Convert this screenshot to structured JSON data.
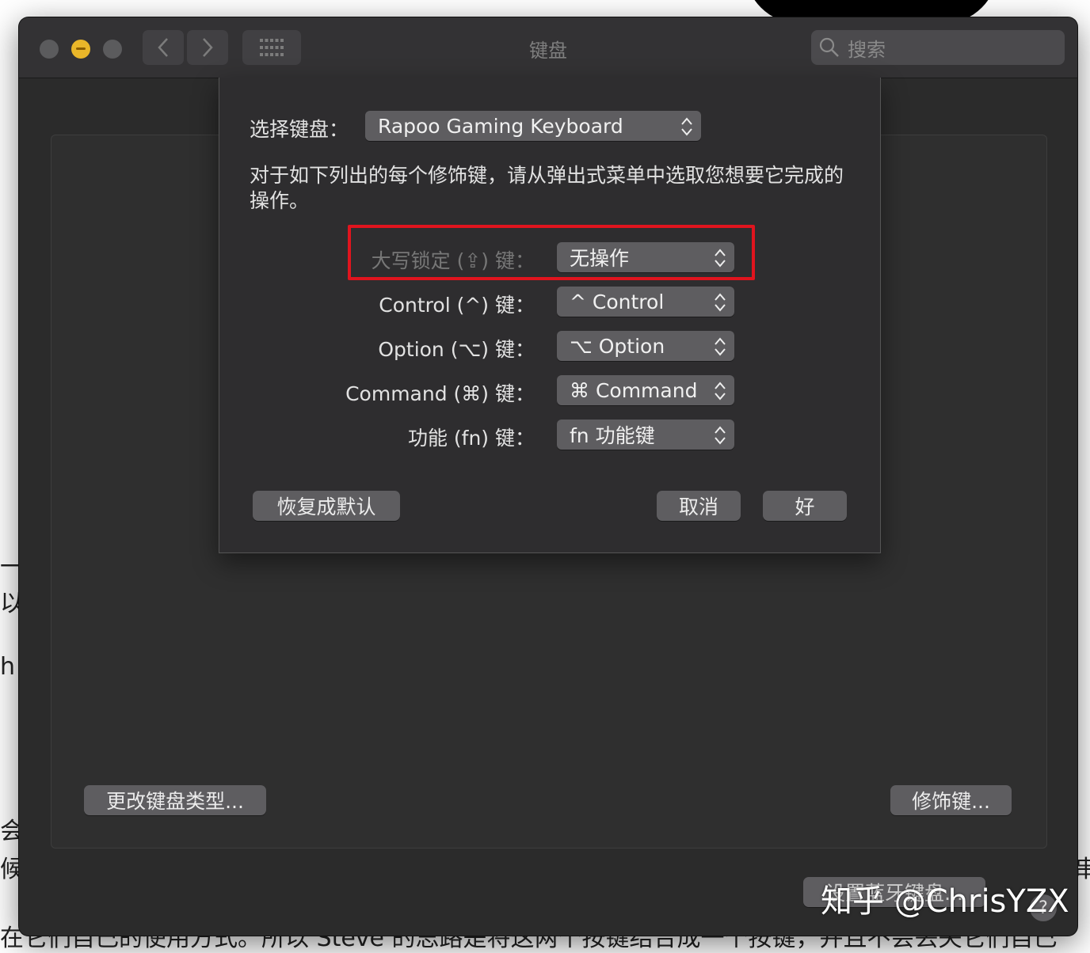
{
  "window": {
    "title": "键盘",
    "search_placeholder": "搜索"
  },
  "sheet": {
    "select_keyboard_label": "选择键盘：",
    "selected_keyboard": "Rapoo Gaming Keyboard",
    "instruction": "对于如下列出的每个修饰键，请从弹出式菜单中选取您想要它完成的操作。",
    "modifiers": [
      {
        "label": "大写锁定 (⇪) 键：",
        "value": "无操作",
        "dimmed": true
      },
      {
        "label": "Control (^) 键：",
        "value": "^ Control"
      },
      {
        "label": "Option (⌥) 键：",
        "value": "⌥ Option"
      },
      {
        "label": "Command (⌘) 键：",
        "value": "⌘ Command"
      },
      {
        "label": "功能 (fn) 键：",
        "value": "fn 功能键"
      }
    ],
    "restore_defaults": "恢复成默认",
    "cancel": "取消",
    "ok": "好"
  },
  "panel": {
    "change_keyboard_type": "更改键盘类型...",
    "modifier_keys": "修饰键...",
    "bluetooth_button": "设置蓝牙键盘..."
  },
  "watermark": "知乎 @ChrisYZX",
  "background_fragments": {
    "left_1": "一",
    "left_2": "以",
    "left_3": "h",
    "left_4": "会",
    "left_5": "候",
    "right_1": "串",
    "bottom_line": "在它们自己的使用方式。所以 Steve 的思路是将这两个按键结合成一个按键，并且不会丢失它们自己"
  },
  "colors": {
    "highlight_border": "#e0141e",
    "minimize_button": "#e9b629"
  }
}
